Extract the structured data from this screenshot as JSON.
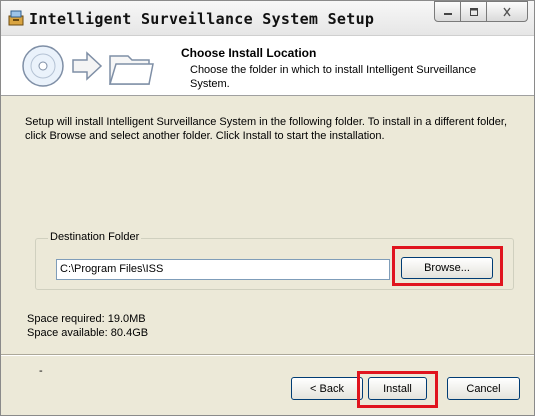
{
  "window": {
    "title": "Intelligent Surveillance System Setup"
  },
  "header": {
    "title": "Choose Install Location",
    "subtitle": "Choose the folder in which to install Intelligent Surveillance System."
  },
  "main": {
    "intro": "Setup will install Intelligent Surveillance System in the following folder. To install in a different folder, click Browse and select another folder. Click Install to start the installation.",
    "destination_label": "Destination Folder",
    "destination_value": "C:\\Program Files\\ISS",
    "browse_label": "Browse...",
    "space_required": "Space required: 19.0MB",
    "space_available": "Space available: 80.4GB",
    "dash": "-"
  },
  "buttons": {
    "back": "< Back",
    "install": "Install",
    "cancel": "Cancel"
  },
  "colors": {
    "highlight": "#e0141e",
    "window_bg": "#ece9d8",
    "button_border": "#003c74"
  }
}
